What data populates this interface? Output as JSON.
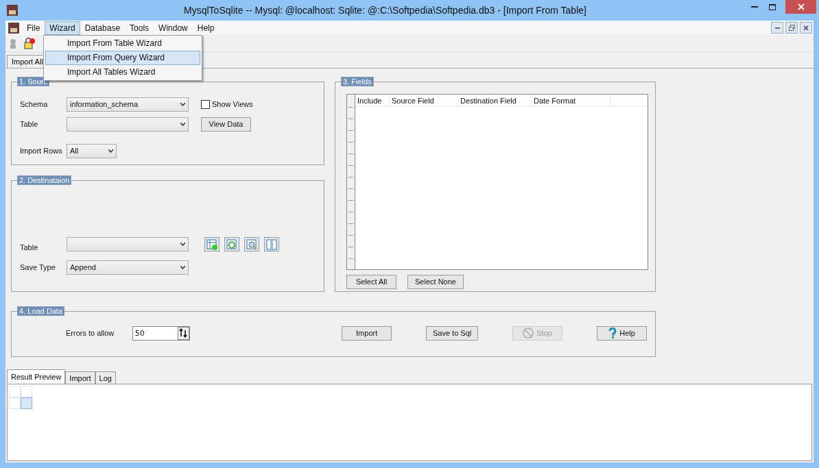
{
  "window": {
    "title": "MysqlToSqlite -- Mysql: @localhost: Sqlite: @:C:\\Softpedia\\Softpedia.db3 - [Import From Table]"
  },
  "menu": [
    {
      "label": "File",
      "selected": false
    },
    {
      "label": "Wizard",
      "selected": true
    },
    {
      "label": "Database",
      "selected": false
    },
    {
      "label": "Tools",
      "selected": false
    },
    {
      "label": "Window",
      "selected": false
    },
    {
      "label": "Help",
      "selected": false
    }
  ],
  "wizard_menu": [
    {
      "label": "Import From Table Wizard",
      "selected": false
    },
    {
      "label": "Import From Query Wizard",
      "selected": true
    },
    {
      "label": "Import All Tables Wizard",
      "selected": false
    }
  ],
  "doc_tabs": [
    {
      "label": "Import All",
      "selected": false
    }
  ],
  "source": {
    "title": "1. Sourc",
    "schema_label": "Schema",
    "schema_value": "information_schema",
    "table_label": "Table",
    "show_views": {
      "label": "Show Views",
      "checked": false
    },
    "view_data": "View Data",
    "rows_label": "Import Rows",
    "rows_value": "All"
  },
  "destination": {
    "title": "2. Destinataion",
    "table_label": "Table",
    "save_type_label": "Save Type",
    "save_type_value": "Append"
  },
  "fields": {
    "title": "3. Fields",
    "columns": [
      "Include",
      "Source Field",
      "Destination Field",
      "Date Format"
    ],
    "select_all": "Select All",
    "select_none": "Select None"
  },
  "load": {
    "title": "4. Load Data",
    "errors_label": "Errors to allow",
    "errors_value": "50",
    "buttons": [
      {
        "label": "Import",
        "disabled": false,
        "kind": "plain"
      },
      {
        "label": "Save to Sql",
        "disabled": false,
        "kind": "plain"
      },
      {
        "label": "Stop",
        "disabled": true,
        "kind": "stop"
      },
      {
        "label": "Help",
        "disabled": false,
        "kind": "help"
      }
    ]
  },
  "result_tabs": [
    {
      "label": "Result Preview",
      "selected": true
    },
    {
      "label": "Import",
      "selected": false
    },
    {
      "label": "Log",
      "selected": false
    }
  ]
}
